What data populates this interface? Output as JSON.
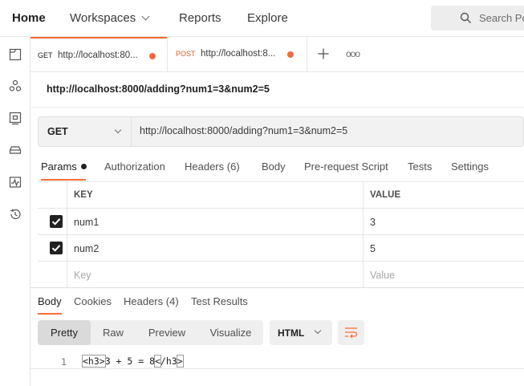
{
  "topnav": {
    "home": "Home",
    "workspaces": "Workspaces",
    "reports": "Reports",
    "explore": "Explore",
    "search_placeholder": "Search Po"
  },
  "sidebar": {
    "icons": [
      "collections-icon",
      "apis-icon",
      "environments-icon",
      "mock-servers-icon",
      "monitors-icon",
      "history-icon"
    ]
  },
  "tabs": [
    {
      "method": "GET",
      "method_color": "#1a1a1a",
      "url": "http://localhost:80...",
      "active": true
    },
    {
      "method": "POST",
      "method_color": "#e05a2b",
      "url": "http://localhost:8...",
      "active": false
    }
  ],
  "request": {
    "title": "http://localhost:8000/adding?num1=3&num2=5",
    "method": "GET",
    "url": "http://localhost:8000/adding?num1=3&num2=5"
  },
  "request_tabs": {
    "params": "Params",
    "authorization": "Authorization",
    "headers": "Headers",
    "headers_count": "(6)",
    "body": "Body",
    "prerequest": "Pre-request Script",
    "tests": "Tests",
    "settings": "Settings"
  },
  "params": {
    "key_header": "KEY",
    "value_header": "VALUE",
    "rows": [
      {
        "key": "num1",
        "value": "3",
        "checked": true
      },
      {
        "key": "num2",
        "value": "5",
        "checked": true
      }
    ],
    "key_placeholder": "Key",
    "value_placeholder": "Value"
  },
  "response_tabs": {
    "body": "Body",
    "cookies": "Cookies",
    "headers": "Headers",
    "headers_count": "(4)",
    "test_results": "Test Results"
  },
  "view_modes": {
    "pretty": "Pretty",
    "raw": "Raw",
    "preview": "Preview",
    "visualize": "Visualize"
  },
  "format": "HTML",
  "code": {
    "line_number": "1",
    "open_tag": "<h3>",
    "content": "3 + 5 = 8",
    "close_lt": "<",
    "close_rest": "/h3",
    "close_gt": ">"
  },
  "colors": {
    "accent": "#ff6c37",
    "unsaved_dot": "#f26b3a"
  }
}
